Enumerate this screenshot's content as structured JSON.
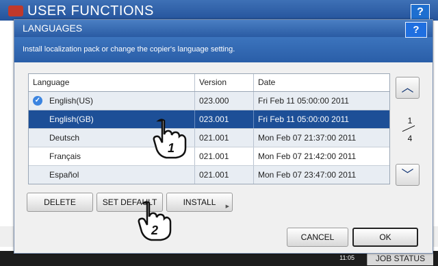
{
  "background": {
    "title": "USER FUNCTIONS",
    "help_label": "?",
    "clock": "11:05",
    "job_status": "JOB STATUS"
  },
  "dialog": {
    "title": "LANGUAGES",
    "help_label": "?",
    "description": "Install localization pack or change the copier's language setting."
  },
  "table": {
    "headers": [
      "Language",
      "Version",
      "Date"
    ],
    "rows": [
      {
        "language": "English(US)",
        "version": "023.000",
        "date": "Fri Feb 11 05:00:00 2011",
        "current": true
      },
      {
        "language": "English(GB)",
        "version": "023.001",
        "date": "Fri Feb 11 05:00:00 2011",
        "selected": true
      },
      {
        "language": "Deutsch",
        "version": "021.001",
        "date": "Mon Feb 07 21:37:00 2011"
      },
      {
        "language": "Français",
        "version": "021.001",
        "date": "Mon Feb 07 21:42:00 2011"
      },
      {
        "language": "Español",
        "version": "021.001",
        "date": "Mon Feb 07 23:47:00 2011"
      }
    ]
  },
  "pager": {
    "current": "1",
    "total": "4"
  },
  "buttons": {
    "delete": "DELETE",
    "set_default": "SET DEFAULT",
    "install": "INSTALL",
    "cancel": "CANCEL",
    "ok": "OK"
  },
  "callouts": {
    "step1": "1",
    "step2": "2"
  }
}
